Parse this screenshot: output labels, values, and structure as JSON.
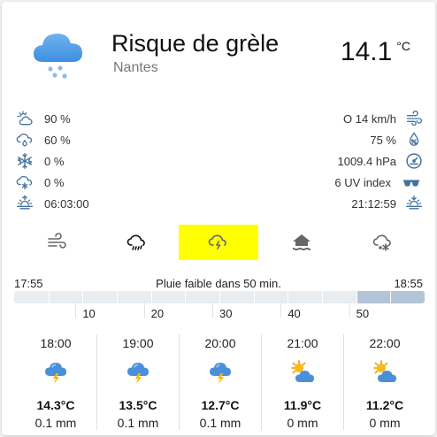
{
  "header": {
    "condition": "Risque de grèle",
    "location": "Nantes",
    "temperature": "14.1",
    "temperature_unit": "°C"
  },
  "left_details": [
    {
      "icon": "sun-cloud-icon",
      "value": "90 %"
    },
    {
      "icon": "rain-drops-cloud-icon",
      "value": "60 %"
    },
    {
      "icon": "snowflake-icon",
      "value": "0 %"
    },
    {
      "icon": "snow-cloud-icon",
      "value": "0 %"
    },
    {
      "icon": "sunrise-icon",
      "value": "06:03:00"
    }
  ],
  "right_details": [
    {
      "icon": "wind-icon",
      "value": "O 14 km/h"
    },
    {
      "icon": "humidity-icon",
      "value": "75 %"
    },
    {
      "icon": "gauge-icon",
      "value": "1009.4 hPa"
    },
    {
      "icon": "sunglasses-icon",
      "value": "6 UV index"
    },
    {
      "icon": "sunset-icon",
      "value": "21:12:59"
    }
  ],
  "tabs": [
    {
      "icon": "wind-tab-icon",
      "active": false
    },
    {
      "icon": "rain-cloud-tab-icon",
      "active": false
    },
    {
      "icon": "storm-cloud-tab-icon",
      "active": true
    },
    {
      "icon": "home-flood-tab-icon",
      "active": false
    },
    {
      "icon": "snow-cloud-tab-icon",
      "active": false
    }
  ],
  "rain_timeline": {
    "start": "17:55",
    "message": "Pluie faible dans 50 min.",
    "end": "18:55",
    "tick_labels": [
      "10",
      "20",
      "30",
      "40",
      "50"
    ],
    "rain_starts_at_minute": 50,
    "total_minutes": 60
  },
  "forecast": [
    {
      "time": "18:00",
      "icon": "thunderstorm-icon",
      "temp": "14.3°C",
      "precip": "0.1 mm"
    },
    {
      "time": "19:00",
      "icon": "thunderstorm-icon",
      "temp": "13.5°C",
      "precip": "0.1 mm"
    },
    {
      "time": "20:00",
      "icon": "thunderstorm-icon",
      "temp": "12.7°C",
      "precip": "0.1 mm"
    },
    {
      "time": "21:00",
      "icon": "partly-cloudy-icon",
      "temp": "11.9°C",
      "precip": "0 mm"
    },
    {
      "time": "22:00",
      "icon": "partly-cloudy-icon",
      "temp": "11.2°C",
      "precip": "0 mm"
    }
  ],
  "colors": {
    "accent_blue": "#4a90d9",
    "icon_slate": "#44739e",
    "active_tab": "#ffff00",
    "bar_bg": "#e8edf2",
    "bar_fill": "#b3c4d6"
  }
}
